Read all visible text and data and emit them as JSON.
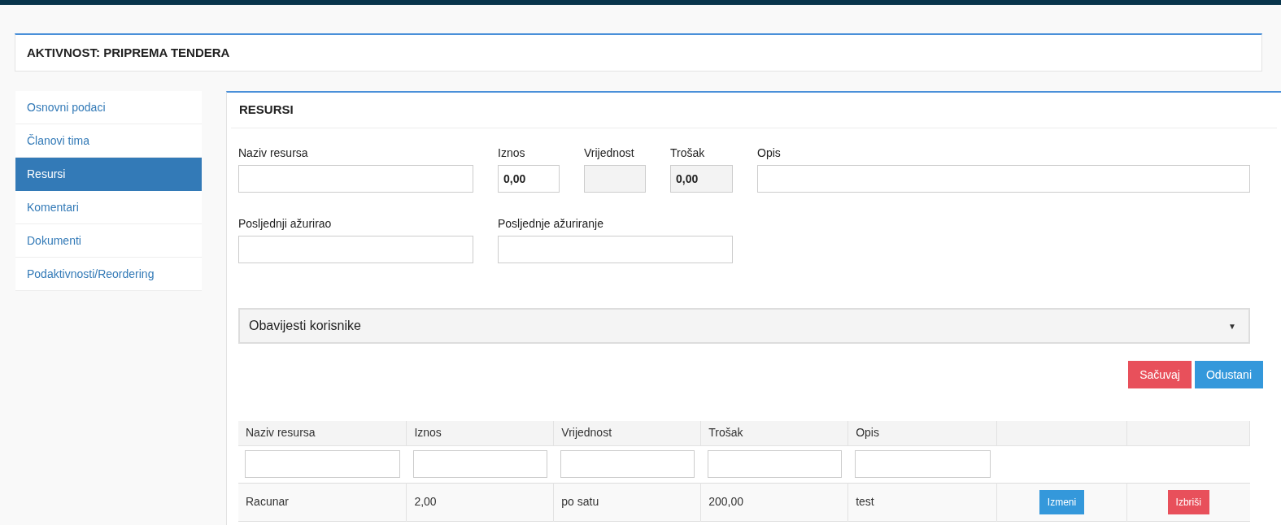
{
  "header": {
    "title": "AKTIVNOST: PRIPREMA TENDERA"
  },
  "sidebar": {
    "items": [
      {
        "label": "Osnovni podaci",
        "selected": false
      },
      {
        "label": "Članovi tima",
        "selected": false
      },
      {
        "label": "Resursi",
        "selected": true
      },
      {
        "label": "Komentari",
        "selected": false
      },
      {
        "label": "Dokumenti",
        "selected": false
      },
      {
        "label": "Podaktivnosti/Reordering",
        "selected": false
      }
    ]
  },
  "panel": {
    "title": "RESURSI",
    "form": {
      "rows": [
        [
          {
            "label": "Naziv resursa",
            "disabled": false
          },
          {
            "label": "Iznos",
            "value": "0,00",
            "disabled": false
          },
          {
            "label": "Vrijednost",
            "disabled": true
          },
          {
            "label": "Trošak",
            "value": "0,00",
            "disabled": true
          },
          {
            "label": "Opis",
            "disabled": false
          }
        ],
        [
          {
            "label": "Posljednji ažurirao",
            "disabled": false
          },
          {
            "label": "Posljednje ažuriranje",
            "disabled": false
          }
        ]
      ]
    },
    "select": {
      "value": "Obavijesti korisnike",
      "arrow": "▼"
    },
    "buttons": [
      {
        "label": "Sačuvaj",
        "kind": "danger"
      },
      {
        "label": "Odustani",
        "kind": "primary"
      }
    ],
    "table": {
      "columns": [
        {
          "label": "Naziv resursa",
          "filter": true
        },
        {
          "label": "Iznos",
          "filter": true
        },
        {
          "label": "Vrijednost",
          "filter": true
        },
        {
          "label": "Trošak",
          "filter": true
        },
        {
          "label": "Opis",
          "filter": true
        },
        {
          "filter": false
        },
        {
          "filter": false
        }
      ],
      "rows": [
        {
          "cells": [
            "Racunar",
            "2,00",
            "po satu",
            "200,00",
            "test"
          ],
          "actions": [
            {
              "label": "Izmeni",
              "kind": "primary"
            },
            {
              "label": "Izbriši",
              "kind": "danger"
            }
          ]
        }
      ]
    }
  }
}
